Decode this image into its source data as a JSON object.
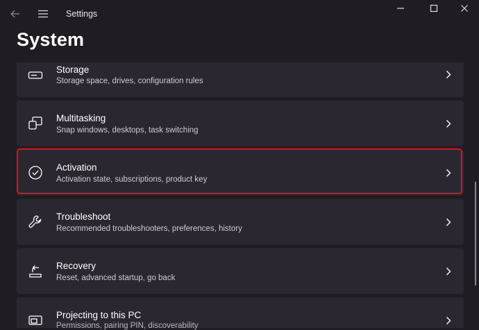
{
  "window": {
    "title": "Settings"
  },
  "page": {
    "title": "System"
  },
  "items": [
    {
      "title": "Storage",
      "description": "Storage space, drives, configuration rules",
      "icon": "storage-icon"
    },
    {
      "title": "Multitasking",
      "description": "Snap windows, desktops, task switching",
      "icon": "multitasking-icon"
    },
    {
      "title": "Activation",
      "description": "Activation state, subscriptions, product key",
      "icon": "activation-check-icon"
    },
    {
      "title": "Troubleshoot",
      "description": "Recommended troubleshooters, preferences, history",
      "icon": "wrench-icon"
    },
    {
      "title": "Recovery",
      "description": "Reset, advanced startup, go back",
      "icon": "recovery-icon"
    },
    {
      "title": "Projecting to this PC",
      "description": "Permissions, pairing PIN, discoverability",
      "icon": "projecting-icon"
    }
  ],
  "colors": {
    "background": "#201c24",
    "card": "#2b2730",
    "highlight": "#e01020",
    "text": "#ffffff",
    "subtext": "#cfcbd3"
  }
}
